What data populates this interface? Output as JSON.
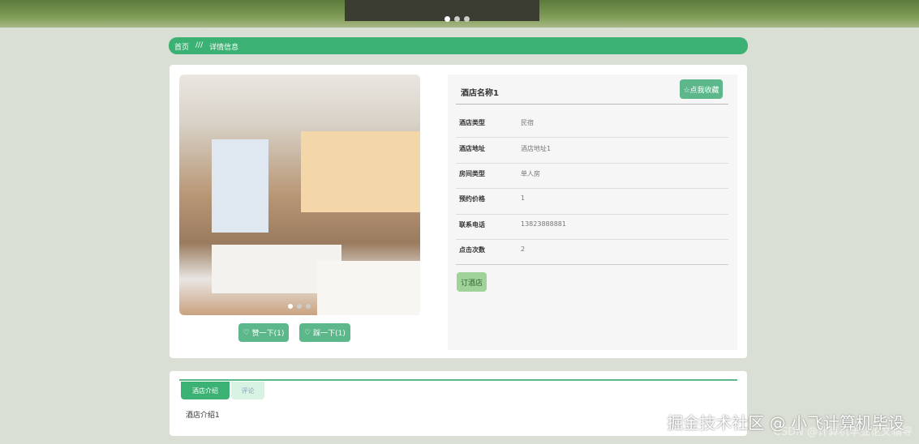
{
  "breadcrumb": {
    "home": "首页",
    "sep": "///",
    "current": "详情信息"
  },
  "detail": {
    "name": "酒店名称1",
    "collect_label": "☆点我收藏",
    "fields": [
      {
        "label": "酒店类型",
        "value": "民宿"
      },
      {
        "label": "酒店地址",
        "value": "酒店地址1"
      },
      {
        "label": "房间类型",
        "value": "单人房"
      },
      {
        "label": "预约价格",
        "value": "1"
      },
      {
        "label": "联系电话",
        "value": "13823888881"
      },
      {
        "label": "点击次数",
        "value": "2"
      }
    ],
    "book_label": "订酒店",
    "like_label": "赞一下(1)",
    "dislike_label": "踩一下(1)"
  },
  "tabs": [
    {
      "label": "酒店介绍"
    },
    {
      "label": "评论"
    }
  ],
  "tab_content": "酒店介绍1",
  "watermark": "掘金技术社区 @ 小飞计算机毕设",
  "watermark2": "CSDN @计算机毕业论文辅导",
  "colors": {
    "accent": "#3bb173",
    "button": "#5cb88a"
  }
}
